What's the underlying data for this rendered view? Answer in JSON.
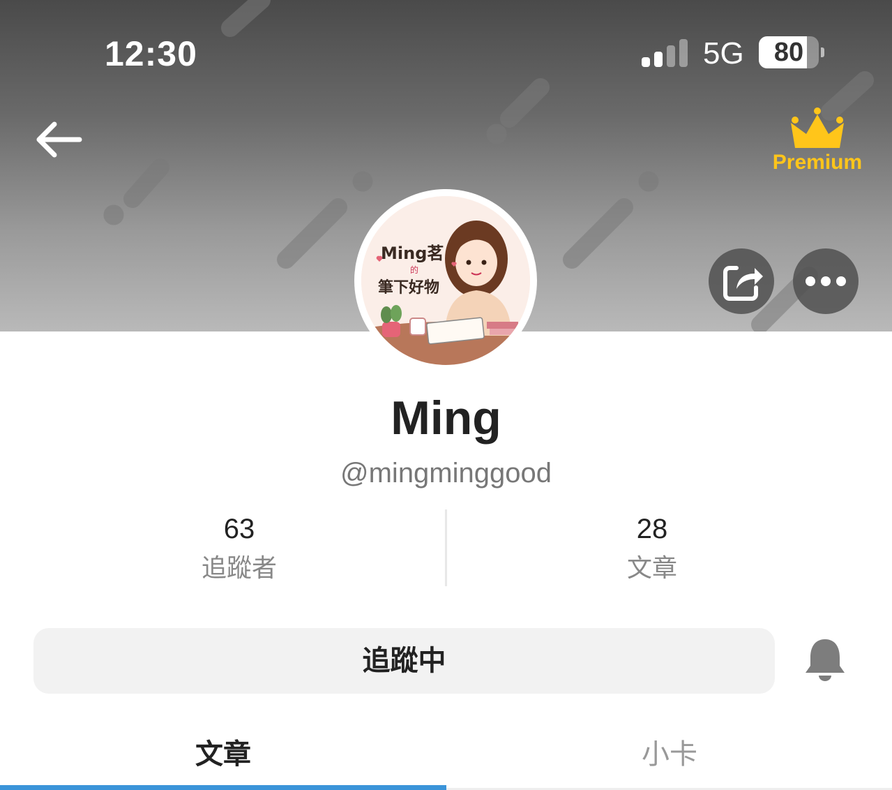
{
  "status_bar": {
    "time": "12:30",
    "network": "5G",
    "battery": "80",
    "battery_level": 0.8,
    "signal_bars_active": 2,
    "signal_bars_total": 4
  },
  "header": {
    "back_icon": "arrow-left-icon",
    "premium_icon": "crown-icon",
    "premium_label": "Premium",
    "premium_color": "#ffc51a",
    "share_icon": "share-icon",
    "more_icon": "more-dots-icon"
  },
  "profile": {
    "avatar_text_line1": "Ming茗",
    "avatar_text_line2": "的",
    "avatar_text_line3": "筆下好物",
    "name": "Ming",
    "handle": "@mingminggood"
  },
  "stats": [
    {
      "value": "63",
      "label": "追蹤者"
    },
    {
      "value": "28",
      "label": "文章"
    }
  ],
  "actions": {
    "follow_label": "追蹤中",
    "bell_icon": "bell-icon"
  },
  "tabs": [
    {
      "label": "文章",
      "active": true
    },
    {
      "label": "小卡",
      "active": false
    }
  ],
  "colors": {
    "accent": "#3b94d9",
    "text_primary": "#222222",
    "text_secondary": "#888888"
  }
}
